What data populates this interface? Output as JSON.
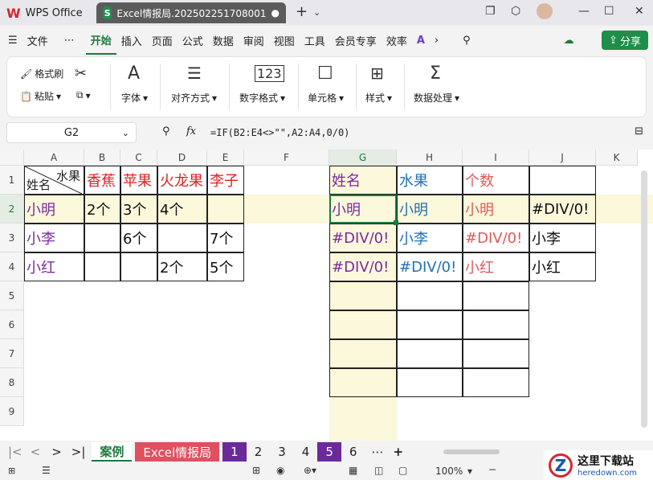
{
  "titlebar": {
    "app_tab": "WPS Office",
    "doc_tab": "Excel情报局.202502251708001",
    "new_tab": "+"
  },
  "menubar": {
    "file": "文件",
    "more": "⋯",
    "items": [
      "开始",
      "插入",
      "页面",
      "公式",
      "数据",
      "审阅",
      "视图",
      "工具",
      "会员专享",
      "效率"
    ],
    "share": "分享"
  },
  "ribbon": {
    "format_painter": "格式刷",
    "paste": "粘贴",
    "font": "字体",
    "align": "对齐方式",
    "number_format": "数字格式",
    "cell": "单元格",
    "style": "样式",
    "data_process": "数据处理"
  },
  "formula": {
    "cell_ref": "G2",
    "fx": "fx",
    "text": "=IF(B2:E4<>\"\",A2:A4,0/0)"
  },
  "columns": [
    "A",
    "B",
    "C",
    "D",
    "E",
    "F",
    "G",
    "H",
    "I",
    "J",
    "K"
  ],
  "rows": [
    "1",
    "2",
    "3",
    "4",
    "5",
    "6",
    "7",
    "8",
    "9"
  ],
  "table1": {
    "corner_top": "水果",
    "corner_bottom": "姓名",
    "headers": [
      "香蕉",
      "苹果",
      "火龙果",
      "李子"
    ],
    "names": [
      "小明",
      "小李",
      "小红"
    ],
    "values": [
      [
        "2个",
        "3个",
        "4个",
        ""
      ],
      [
        "",
        "6个",
        "",
        "7个"
      ],
      [
        "",
        "",
        "2个",
        "5个"
      ]
    ]
  },
  "table2": {
    "headers": [
      "姓名",
      "水果",
      "个数",
      ""
    ],
    "rows": [
      [
        "小明",
        "小明",
        "小明",
        "#DIV/0!"
      ],
      [
        "#DIV/0!",
        "小李",
        "#DIV/0!",
        "小李"
      ],
      [
        "#DIV/0!",
        "#DIV/0!",
        "小红",
        "小红"
      ]
    ]
  },
  "sheets": {
    "tabs": [
      "案例",
      "Excel情报局",
      "1",
      "2",
      "3",
      "4",
      "5",
      "6"
    ],
    "more": "⋯",
    "add": "+"
  },
  "status": {
    "zoom": "100%",
    "watermark": "这里下载站",
    "watermark_sub": "heredown.com"
  },
  "colors": {
    "accent": "#1b7a3d",
    "red": "#e02020",
    "purple": "#7a2aa0",
    "blue": "#1f6fb8",
    "pink": "#e05a5a",
    "sheet_active": "#1b7a3d",
    "sheet_red": "#e05060",
    "sheet_purple": "#6a2a9a"
  }
}
